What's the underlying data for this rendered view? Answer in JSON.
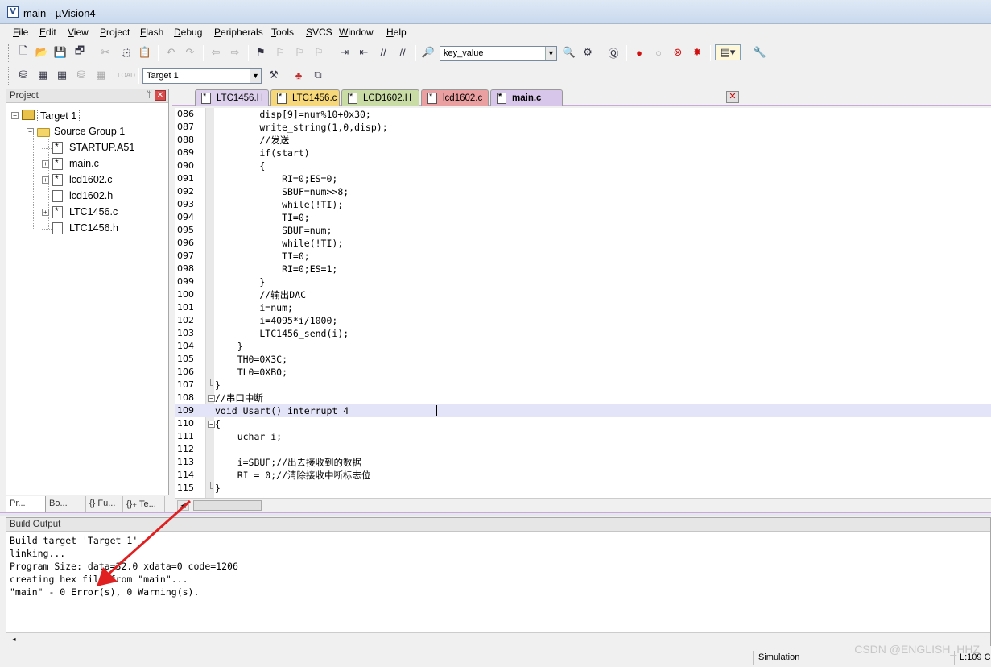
{
  "window": {
    "title": "main  - µVision4",
    "app_icon_letter": "V"
  },
  "menu": [
    {
      "label": "File",
      "u": "F",
      "rest": "ile"
    },
    {
      "label": "Edit",
      "u": "E",
      "rest": "dit"
    },
    {
      "label": "View",
      "u": "V",
      "rest": "iew"
    },
    {
      "label": "Project",
      "u": "P",
      "rest": "roject"
    },
    {
      "label": "Flash",
      "u": "F",
      "rest": "lash"
    },
    {
      "label": "Debug",
      "u": "D",
      "rest": "ebug"
    },
    {
      "label": "Peripherals",
      "u": "P",
      "rest": "eripherals"
    },
    {
      "label": "Tools",
      "u": "T",
      "rest": "ools"
    },
    {
      "label": "SVCS",
      "u": "S",
      "rest": "VCS"
    },
    {
      "label": "Window",
      "u": "W",
      "rest": "indow"
    },
    {
      "label": "Help",
      "u": "H",
      "rest": "elp"
    }
  ],
  "toolbar": {
    "find_value": "key_value",
    "target_select": "Target 1"
  },
  "project_panel": {
    "title": "Project",
    "pin": "ᛘ",
    "tree": [
      {
        "label": "Target 1",
        "level": 0,
        "expander": "−",
        "icon": "target"
      },
      {
        "label": "Source Group 1",
        "level": 1,
        "expander": "−",
        "icon": "folder"
      },
      {
        "label": "STARTUP.A51",
        "level": 2,
        "expander": "",
        "icon": "doc-star"
      },
      {
        "label": "main.c",
        "level": 2,
        "expander": "+",
        "icon": "doc-star"
      },
      {
        "label": "lcd1602.c",
        "level": 2,
        "expander": "+",
        "icon": "doc-star"
      },
      {
        "label": "lcd1602.h",
        "level": 2,
        "expander": "",
        "icon": "doc"
      },
      {
        "label": "LTC1456.c",
        "level": 2,
        "expander": "+",
        "icon": "doc-star"
      },
      {
        "label": "LTC1456.h",
        "level": 2,
        "expander": "",
        "icon": "doc"
      }
    ],
    "bottom_tabs": [
      "Pr...",
      "Bo...",
      "{} Fu...",
      "{}₊ Te..."
    ]
  },
  "editor_tabs": [
    {
      "label": "LTC1456.H",
      "color": "#dcd0ec",
      "active": false
    },
    {
      "label": "LTC1456.c",
      "color": "#f6d77a",
      "active": false
    },
    {
      "label": "LCD1602.H",
      "color": "#c9dca6",
      "active": false
    },
    {
      "label": "lcd1602.c",
      "color": "#eaa0a0",
      "active": false
    },
    {
      "label": "main.c",
      "color": "#d7c6ea",
      "active": true
    }
  ],
  "code_lines": [
    {
      "n": "086",
      "text": "        disp[9]=num%10+0x30;",
      "fold": ""
    },
    {
      "n": "087",
      "text": "        write_string(1,0,disp);",
      "fold": ""
    },
    {
      "n": "088",
      "text": "        //发送",
      "fold": ""
    },
    {
      "n": "089",
      "text": "        if(start)",
      "fold": ""
    },
    {
      "n": "090",
      "text": "        {",
      "fold": ""
    },
    {
      "n": "091",
      "text": "            RI=0;ES=0;",
      "fold": ""
    },
    {
      "n": "092",
      "text": "            SBUF=num>>8;",
      "fold": ""
    },
    {
      "n": "093",
      "text": "            while(!TI);",
      "fold": ""
    },
    {
      "n": "094",
      "text": "            TI=0;",
      "fold": ""
    },
    {
      "n": "095",
      "text": "            SBUF=num;",
      "fold": ""
    },
    {
      "n": "096",
      "text": "            while(!TI);",
      "fold": ""
    },
    {
      "n": "097",
      "text": "            TI=0;",
      "fold": ""
    },
    {
      "n": "098",
      "text": "            RI=0;ES=1;",
      "fold": ""
    },
    {
      "n": "099",
      "text": "        }",
      "fold": ""
    },
    {
      "n": "100",
      "text": "        //输出DAC",
      "fold": ""
    },
    {
      "n": "101",
      "text": "        i=num;",
      "fold": ""
    },
    {
      "n": "102",
      "text": "        i=4095*i/1000;",
      "fold": ""
    },
    {
      "n": "103",
      "text": "        LTC1456_send(i);",
      "fold": ""
    },
    {
      "n": "104",
      "text": "    }",
      "fold": ""
    },
    {
      "n": "105",
      "text": "    TH0=0X3C;",
      "fold": ""
    },
    {
      "n": "106",
      "text": "    TL0=0XB0;",
      "fold": ""
    },
    {
      "n": "107",
      "text": "}",
      "fold": "end"
    },
    {
      "n": "108",
      "text": "//串口中断",
      "fold": "box"
    },
    {
      "n": "109",
      "text": "void Usart() interrupt 4",
      "fold": "",
      "current": true
    },
    {
      "n": "110",
      "text": "{",
      "fold": "box"
    },
    {
      "n": "111",
      "text": "    uchar i;",
      "fold": ""
    },
    {
      "n": "112",
      "text": "",
      "fold": ""
    },
    {
      "n": "113",
      "text": "    i=SBUF;//出去接收到的数据",
      "fold": ""
    },
    {
      "n": "114",
      "text": "    RI = 0;//清除接收中断标志位",
      "fold": ""
    },
    {
      "n": "115",
      "text": "}",
      "fold": "end"
    }
  ],
  "build_output": {
    "title": "Build Output",
    "lines": [
      "Build target 'Target 1'",
      "linking...",
      "Program Size: data=32.0 xdata=0 code=1206",
      "creating hex file from \"main\"...",
      "\"main\" - 0 Error(s), 0 Warning(s)."
    ]
  },
  "status": {
    "mode": "Simulation",
    "position": "L:109 C"
  },
  "watermark": "CSDN @ENGLISH_HHZ",
  "colors": {
    "annotation_arrow": "#e02020",
    "tab_accent": "#c9a9d9"
  }
}
